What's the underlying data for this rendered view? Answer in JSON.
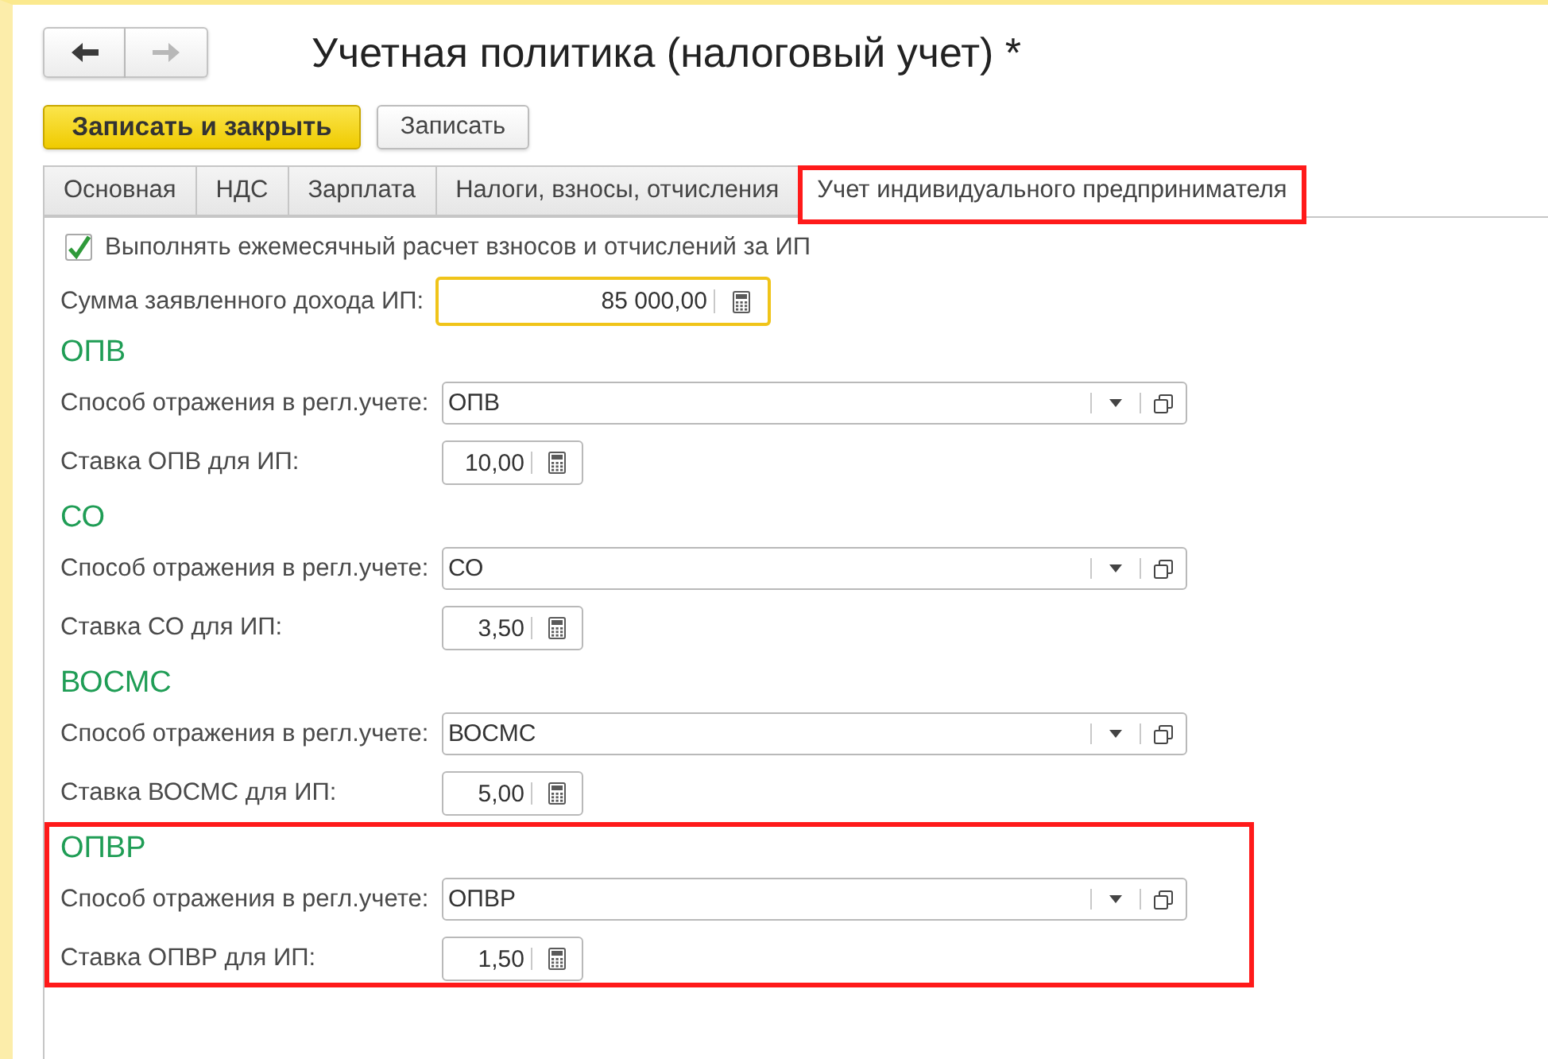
{
  "nav": {
    "back": {
      "disabled": false
    },
    "forward": {
      "disabled": true
    }
  },
  "window": {
    "title": "Учетная политика (налоговый учет) *"
  },
  "toolbar": {
    "buttons": [
      {
        "label": "Записать и закрыть",
        "kind": "primary"
      },
      {
        "label": "Записать",
        "kind": "default"
      }
    ]
  },
  "tabs": [
    {
      "label": "Основная",
      "selected": false,
      "highlighted": false
    },
    {
      "label": "НДС",
      "selected": false,
      "highlighted": false
    },
    {
      "label": "Зарплата",
      "selected": false,
      "highlighted": false
    },
    {
      "label": "Налоги, взносы, отчисления",
      "selected": false,
      "highlighted": false
    },
    {
      "label": "Учет индивидуального предпринимателя",
      "selected": true,
      "highlighted": true
    }
  ],
  "form": {
    "monthly_calculation": {
      "label": "Выполнять ежемесячный расчет взносов и отчислений за ИП",
      "checked": true
    },
    "declared_income": {
      "label": "Сумма заявленного дохода ИП:",
      "value": "85 000,00",
      "focused": true
    },
    "sections": [
      {
        "title": "ОПВ",
        "highlighted": false,
        "method": {
          "label": "Способ отражения в регл.учете:",
          "value": "ОПВ"
        },
        "rate": {
          "label": "Ставка ОПВ для ИП:",
          "value": "10,00"
        }
      },
      {
        "title": "СО",
        "highlighted": false,
        "method": {
          "label": "Способ отражения в регл.учете:",
          "value": "СО"
        },
        "rate": {
          "label": "Ставка СО для ИП:",
          "value": "3,50"
        }
      },
      {
        "title": "ВОСМС",
        "highlighted": false,
        "method": {
          "label": "Способ отражения в регл.учете:",
          "value": "ВОСМС"
        },
        "rate": {
          "label": "Ставка ВОСМС для ИП:",
          "value": "5,00"
        }
      },
      {
        "title": "ОПВР",
        "highlighted": true,
        "method": {
          "label": "Способ отражения в регл.учете:",
          "value": "ОПВР"
        },
        "rate": {
          "label": "Ставка ОПВР для ИП:",
          "value": "1,50"
        }
      }
    ]
  }
}
